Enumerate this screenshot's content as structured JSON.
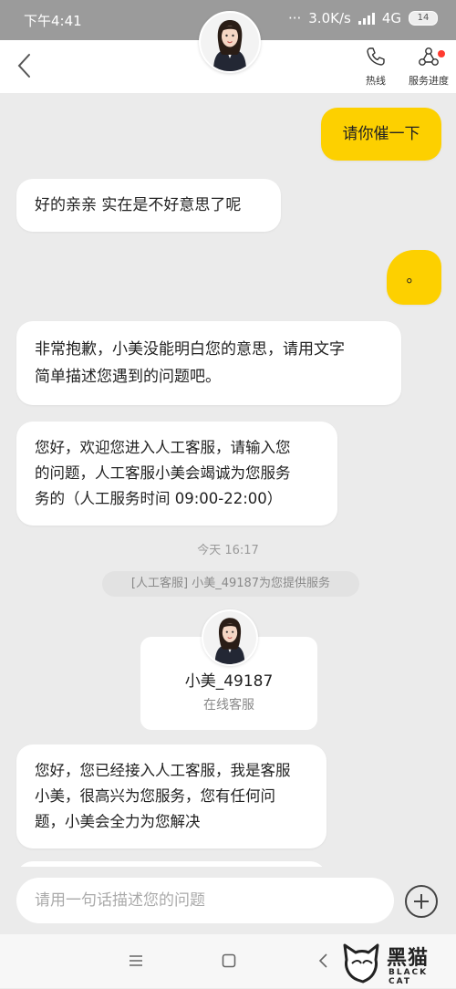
{
  "status_bar": {
    "time": "下午4:41",
    "net_speed": "3.0K/s",
    "network": "4G",
    "battery": "14"
  },
  "header": {
    "hotline_label": "热线",
    "progress_label": "服务进度"
  },
  "messages": [
    {
      "side": "right",
      "text": "请你催一下"
    },
    {
      "side": "left",
      "text": "好的亲亲 实在是不好意思了呢"
    },
    {
      "side": "right",
      "text": "。"
    },
    {
      "side": "left",
      "lines": [
        "非常抱歉，小美没能明白您的意思，请用文字",
        "简单描述您遇到的问题吧。"
      ]
    },
    {
      "side": "left",
      "lines": [
        "您好，欢迎您进入人工客服，请输入您",
        "的问题，人工客服小美会竭诚为您服务",
        "务的（人工服务时间 09:00-22:00）"
      ]
    },
    {
      "side": "left",
      "lines": [
        "您好，您已经接入人工客服，我是客服",
        "小美，很高兴为您服务，您有任何问",
        "题，小美会全力为您解决"
      ]
    }
  ],
  "timestamp": "今天 16:17",
  "notice": "[人工客服] 小美_49187为您提供服务",
  "agent": {
    "name": "小美_49187",
    "role": "在线客服"
  },
  "input": {
    "placeholder": "请用一句话描述您的问题"
  },
  "watermark": {
    "title": "黑猫",
    "subtitle": "BLACK CAT"
  }
}
